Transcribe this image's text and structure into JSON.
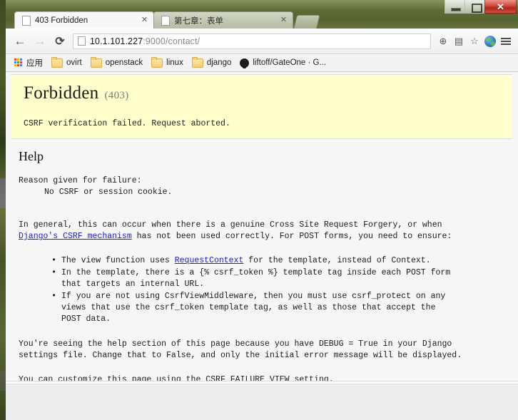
{
  "window": {
    "controls": {
      "minimize_label": "—",
      "maximize_label": "□",
      "close_label": "✕"
    }
  },
  "tabs": [
    {
      "title": "403 Forbidden",
      "close_label": "✕",
      "active": true
    },
    {
      "title": "第七章：表单",
      "close_label": "✕",
      "active": false
    }
  ],
  "toolbar": {
    "back_label": "←",
    "forward_label": "→",
    "reload_label": "⟳",
    "url_host": "10.1.101.227",
    "url_rest": ":9000/contact/",
    "zoom_label": "⊕",
    "translate_label": "▤",
    "star_label": "☆",
    "menu_label": "≡"
  },
  "bookmarks": [
    {
      "label": "应用",
      "icon": "apps-grid-icon"
    },
    {
      "label": "ovirt",
      "icon": "folder-icon"
    },
    {
      "label": "openstack",
      "icon": "folder-icon"
    },
    {
      "label": "linux",
      "icon": "folder-icon"
    },
    {
      "label": "django",
      "icon": "folder-icon"
    },
    {
      "label": "liftoff/GateOne · G...",
      "icon": "github-icon"
    }
  ],
  "page": {
    "title": "Forbidden",
    "status_code": "(403)",
    "lead": "CSRF verification failed. Request aborted.",
    "help_heading": "Help",
    "reason_label": "Reason given for failure:",
    "reason_value": "No CSRF or session cookie.",
    "intro_line1": "In general, this can occur when there is a genuine Cross Site Request Forgery, or when",
    "intro_link": "Django's CSRF mechanism",
    "intro_line2_after_link": " has not been used correctly. For POST forms, you need to ensure:",
    "checks": [
      {
        "before_link": "The view function uses ",
        "link": "RequestContext",
        "after_link": " for the template, instead of Context."
      },
      {
        "line1": "In the template, there is a {% csrf_token %} template tag inside each POST form",
        "line2": "that targets an internal URL."
      },
      {
        "line1": "If you are not using CsrfViewMiddleware, then you must use csrf_protect on any",
        "line2": "views that use the csrf_token template tag, as well as those that accept the",
        "line3": "POST data."
      }
    ],
    "debug_note_line1": "You're seeing the help section of this page because you have DEBUG = True in your Django",
    "debug_note_line2": "settings file. Change that to False, and only the initial error message will be displayed.",
    "customize_note": "You can customize this page using the CSRF_FAILURE_VIEW setting."
  },
  "colors": {
    "banner_bg": "#ffffcc",
    "link": "#2020cc",
    "titlebar": "#5d6a36",
    "close_button": "#cf3b2c",
    "page_bg": "#f6f6f6"
  }
}
